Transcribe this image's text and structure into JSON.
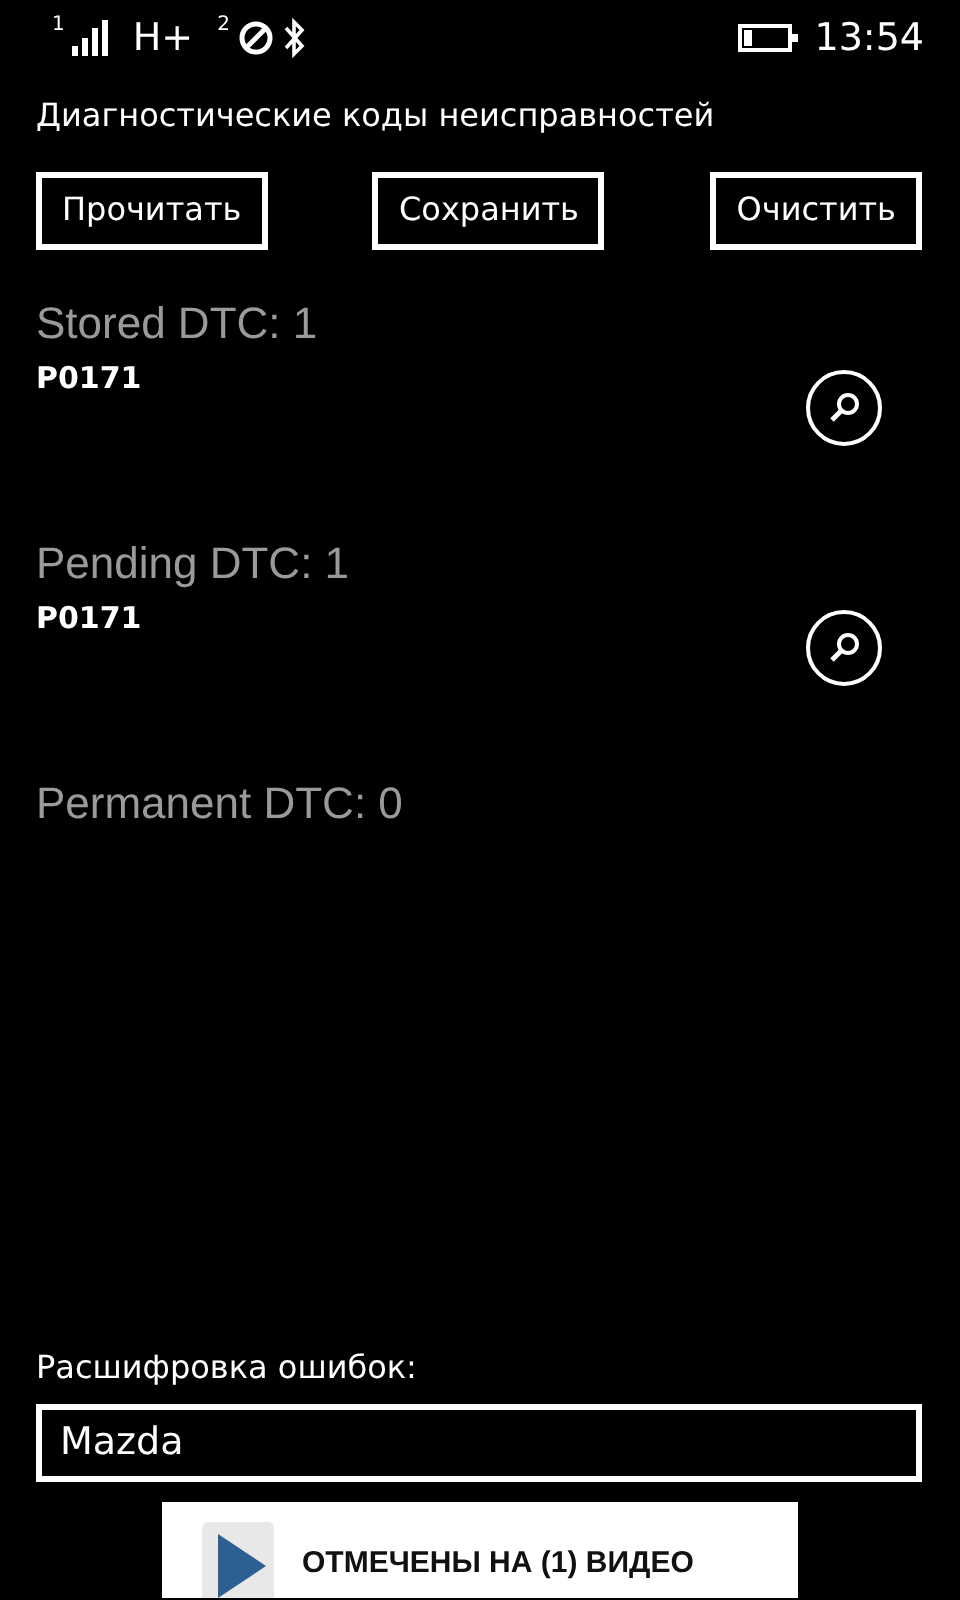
{
  "status_bar": {
    "sim1": "1",
    "network": "H+",
    "sim2": "2",
    "time": "13:54"
  },
  "title": "Диагностические коды неисправностей",
  "buttons": [
    "Прочитать",
    "Сохранить",
    "Очистить"
  ],
  "sections": [
    {
      "heading": "Stored DTC: 1",
      "codes": [
        "P0171"
      ]
    },
    {
      "heading": "Pending DTC: 1",
      "codes": [
        "P0171"
      ]
    },
    {
      "heading": "Permanent DTC: 0"
    }
  ],
  "decode": {
    "label": "Расшифровка ошибок:",
    "value": "Mazda"
  },
  "ad": {
    "text": "ОТМЕЧЕНЫ НА (1) ВИДЕО"
  }
}
